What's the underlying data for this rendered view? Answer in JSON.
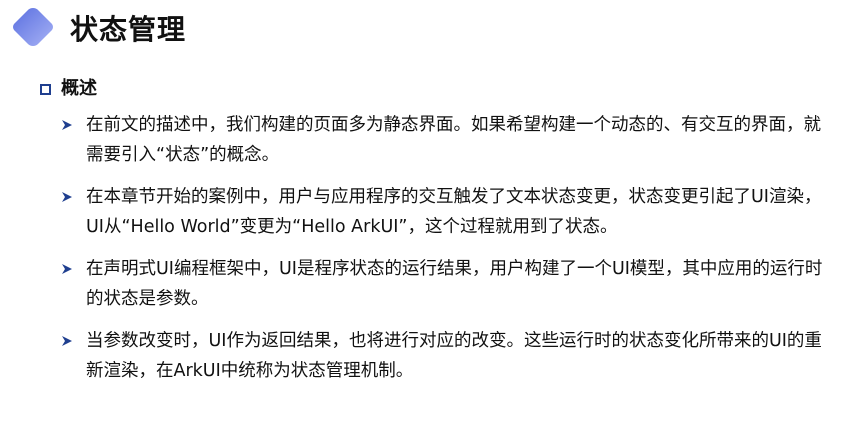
{
  "title": "状态管理",
  "section": {
    "title": "概述"
  },
  "bullets": [
    {
      "text": "在前文的描述中，我们构建的页面多为静态界面。如果希望构建一个动态的、有交互的界面，就需要引入“状态”的概念。"
    },
    {
      "text": "在本章节开始的案例中，用户与应用程序的交互触发了文本状态变更，状态变更引起了UI渲染，UI从“Hello World”变更为“Hello ArkUI”，这个过程就用到了状态。"
    },
    {
      "text": "在声明式UI编程框架中，UI是程序状态的运行结果，用户构建了一个UI模型，其中应用的运行时的状态是参数。"
    },
    {
      "text": "当参数改变时，UI作为返回结果，也将进行对应的改变。这些运行时的状态变化所带来的UI的重新渲染，在ArkUI中统称为状态管理机制。"
    }
  ],
  "colors": {
    "accent": "#1f3f8f",
    "logo_start": "#6a7fe6",
    "logo_end": "#9aa8f2"
  }
}
